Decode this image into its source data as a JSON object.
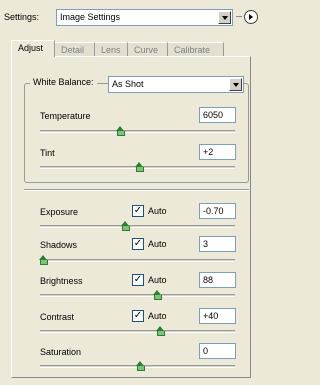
{
  "settings": {
    "label": "Settings:",
    "value": "Image Settings"
  },
  "tabs": [
    {
      "label": "Adjust",
      "active": true
    },
    {
      "label": "Detail",
      "active": false
    },
    {
      "label": "Lens",
      "active": false
    },
    {
      "label": "Curve",
      "active": false
    },
    {
      "label": "Calibrate",
      "active": false
    }
  ],
  "white_balance": {
    "label": "White Balance:",
    "value": "As Shot"
  },
  "sliders": {
    "temperature": {
      "label": "Temperature",
      "value": "6050"
    },
    "tint": {
      "label": "Tint",
      "value": "+2"
    },
    "exposure": {
      "label": "Exposure",
      "value": "-0.70",
      "auto": "Auto"
    },
    "shadows": {
      "label": "Shadows",
      "value": "3",
      "auto": "Auto"
    },
    "brightness": {
      "label": "Brightness",
      "value": "88",
      "auto": "Auto"
    },
    "contrast": {
      "label": "Contrast",
      "value": "+40",
      "auto": "Auto"
    },
    "saturation": {
      "label": "Saturation",
      "value": "0"
    }
  },
  "colors": {
    "slider_thumb": "#2e7d32",
    "background": "#ece9d8"
  }
}
